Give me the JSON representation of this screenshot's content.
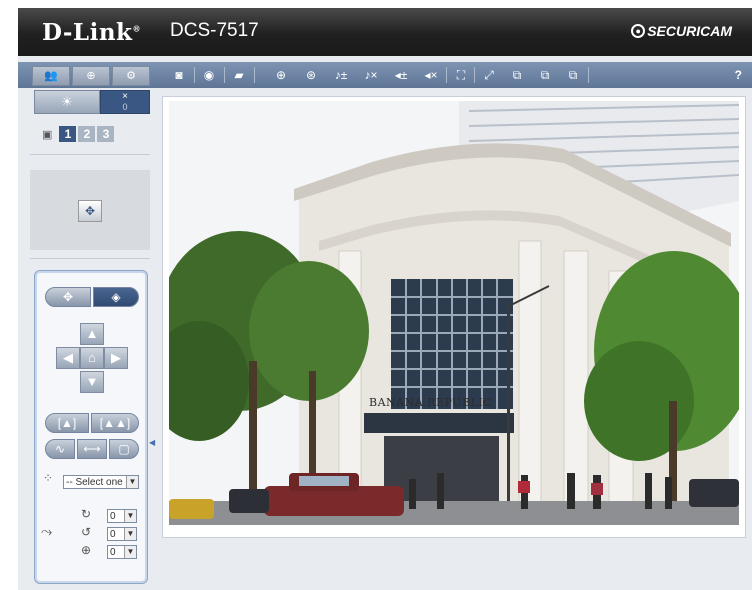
{
  "header": {
    "brand": "D-Link",
    "brand_mark": "®",
    "model": "DCS-7517",
    "partner_logo": "SECURICAM"
  },
  "toolbar": {
    "left_buttons": [
      "people-icon",
      "globe-icon",
      "gear-icon"
    ],
    "tools": [
      "camera-snapshot-icon",
      "record-icon",
      "folder-icon",
      "zoom-in-icon",
      "digital-zoom-icon",
      "mic-volume-icon",
      "mic-mute-icon",
      "speaker-volume-icon",
      "speaker-mute-icon",
      "fullscreen-icon",
      "resize-icon",
      "resolution-1-icon",
      "resolution-2-icon",
      "resolution-3-icon"
    ],
    "help_label": "?"
  },
  "sidebar": {
    "light_off_label": "×",
    "light_value": "0",
    "cameras": [
      "1",
      "2",
      "3"
    ],
    "active_camera": "1",
    "preset_select": "-- Select one --",
    "pan_speed": "0",
    "tilt_speed": "0",
    "zoom_speed": "0"
  },
  "video": {
    "store_sign": "BANANA REPUBLIC"
  }
}
